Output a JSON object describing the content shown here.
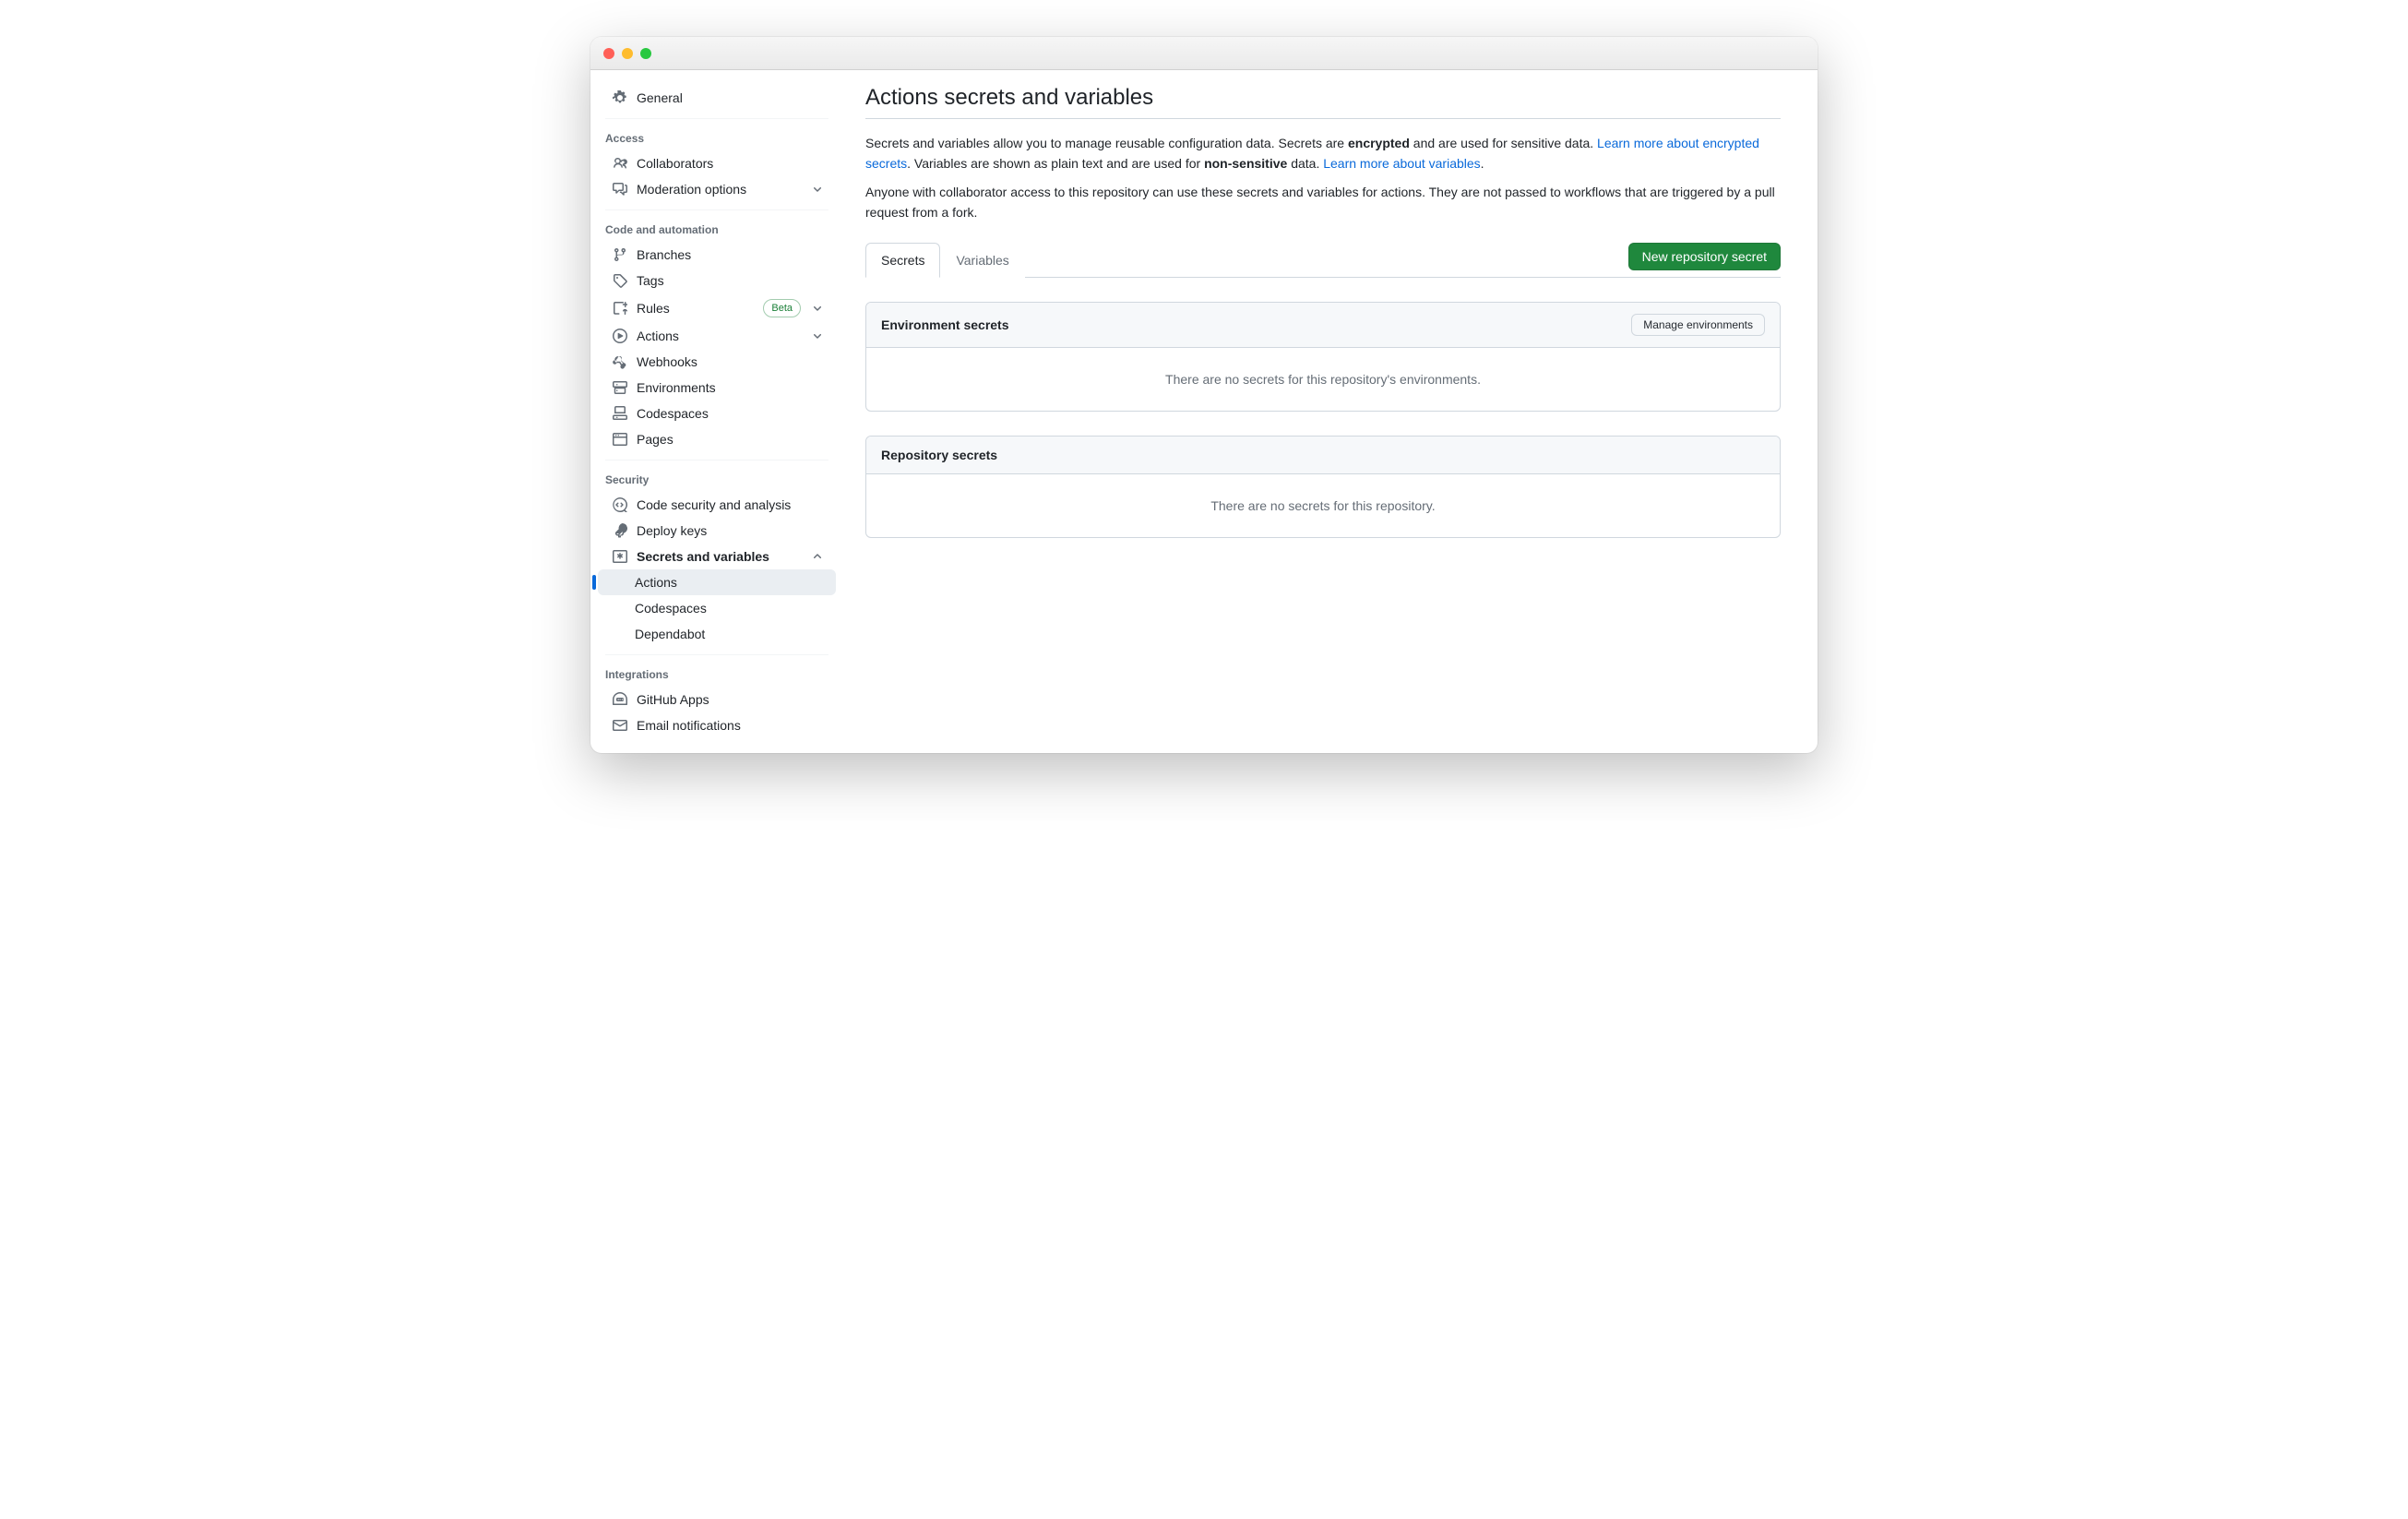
{
  "sidebar": {
    "general": "General",
    "groups": [
      {
        "heading": "Access",
        "items": [
          {
            "label": "Collaborators"
          },
          {
            "label": "Moderation options",
            "expandable": true
          }
        ]
      },
      {
        "heading": "Code and automation",
        "items": [
          {
            "label": "Branches"
          },
          {
            "label": "Tags"
          },
          {
            "label": "Rules",
            "badge": "Beta",
            "expandable": true
          },
          {
            "label": "Actions",
            "expandable": true
          },
          {
            "label": "Webhooks"
          },
          {
            "label": "Environments"
          },
          {
            "label": "Codespaces"
          },
          {
            "label": "Pages"
          }
        ]
      },
      {
        "heading": "Security",
        "items": [
          {
            "label": "Code security and analysis"
          },
          {
            "label": "Deploy keys"
          },
          {
            "label": "Secrets and variables",
            "expandable": true,
            "expanded": true,
            "bold": true,
            "children": [
              {
                "label": "Actions",
                "selected": true
              },
              {
                "label": "Codespaces"
              },
              {
                "label": "Dependabot"
              }
            ]
          }
        ]
      },
      {
        "heading": "Integrations",
        "items": [
          {
            "label": "GitHub Apps"
          },
          {
            "label": "Email notifications"
          }
        ]
      }
    ]
  },
  "main": {
    "title": "Actions secrets and variables",
    "desc1_pre": "Secrets and variables allow you to manage reusable configuration data. Secrets are ",
    "desc1_bold1": "encrypted",
    "desc1_mid": " and are used for sensitive data. ",
    "desc1_link1": "Learn more about encrypted secrets",
    "desc1_mid2": ". Variables are shown as plain text and are used for ",
    "desc1_bold2": "non-sensitive",
    "desc1_post": " data. ",
    "desc1_link2": "Learn more about variables",
    "desc1_end": ".",
    "desc2": "Anyone with collaborator access to this repository can use these secrets and variables for actions. They are not passed to workflows that are triggered by a pull request from a fork.",
    "tabs": {
      "secrets": "Secrets",
      "variables": "Variables"
    },
    "new_secret_btn": "New repository secret",
    "panel1": {
      "title": "Environment secrets",
      "button": "Manage environments",
      "empty": "There are no secrets for this repository's environments."
    },
    "panel2": {
      "title": "Repository secrets",
      "empty": "There are no secrets for this repository."
    }
  }
}
